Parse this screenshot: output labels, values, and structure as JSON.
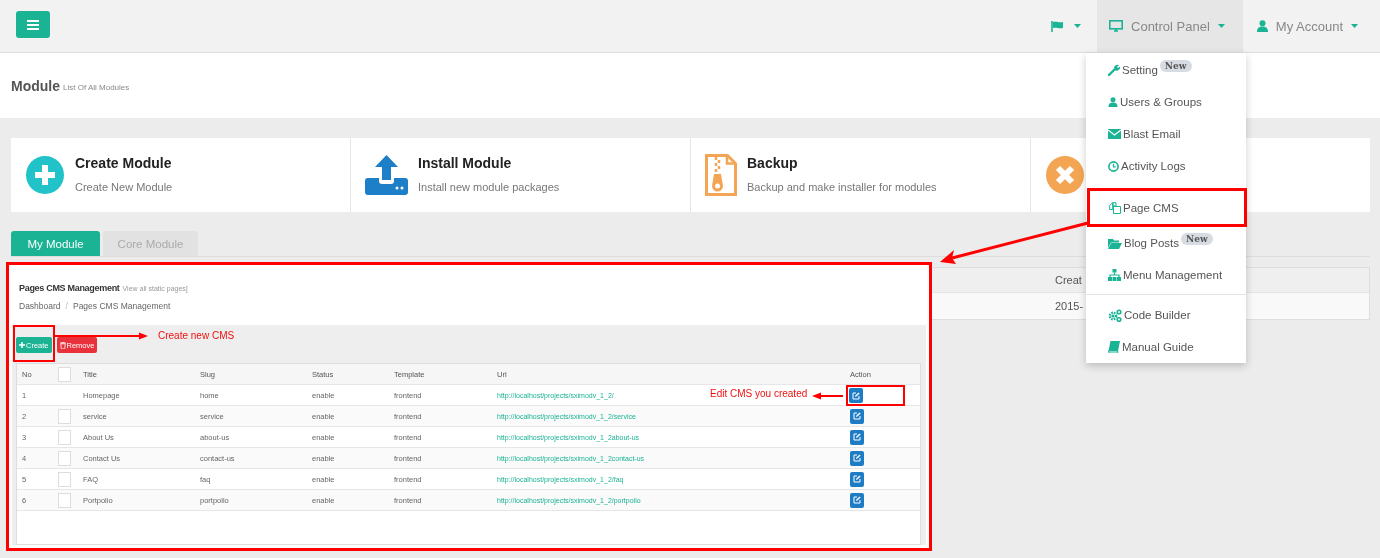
{
  "navbar": {
    "flag_menu": {
      "expanded": false
    },
    "menus": [
      {
        "label": "Control Panel",
        "expanded": true
      },
      {
        "label": "My Account",
        "expanded": false
      }
    ]
  },
  "page_header": {
    "title": "Module",
    "subtitle": "List Of All Modules"
  },
  "cards": [
    {
      "title": "Create Module",
      "description": "Create New Module"
    },
    {
      "title": "Install Module",
      "description": "Install new module packages"
    },
    {
      "title": "Backup",
      "description": "Backup and make installer for modules"
    }
  ],
  "tabs": [
    {
      "label": "My Module",
      "selected": true
    },
    {
      "label": "Core Module",
      "selected": false
    }
  ],
  "module_table": {
    "column_header": "Creat",
    "cell": "2015-"
  },
  "cms_screenshot": {
    "title": "Pages CMS Management",
    "subtitle": "View all static pages]",
    "breadcrumb": {
      "items": [
        "Dashboard",
        "Pages CMS Management"
      ],
      "separator": "/"
    },
    "buttons": [
      {
        "label": "Create",
        "kind": "primary",
        "annotated": true
      },
      {
        "label": "Remove",
        "kind": "danger",
        "annotated": false
      }
    ],
    "columns": [
      "No",
      "Title",
      "Slug",
      "Status",
      "Template",
      "Url",
      "Action"
    ],
    "select_all_checked": false,
    "rows": [
      {
        "no": "1",
        "title": "Homepage",
        "slug": "home",
        "status": "enable",
        "template": "frontend",
        "url": "http://localhost/projects/sximodv_1_2/",
        "annotated": true
      },
      {
        "no": "2",
        "checked": false,
        "title": "service",
        "slug": "service",
        "status": "enable",
        "template": "frontend",
        "url": "http://localhost/projects/sximodv_1_2/service",
        "annotated": false
      },
      {
        "no": "3",
        "checked": false,
        "title": "About Us",
        "slug": "about-us",
        "status": "enable",
        "template": "frontend",
        "url": "http://localhost/projects/sximodv_1_2about-us",
        "annotated": false
      },
      {
        "no": "4",
        "checked": false,
        "title": "Contact Us",
        "slug": "contact-us",
        "status": "enable",
        "template": "frontend",
        "url": "http://localhost/projects/sximodv_1_2contact-us",
        "annotated": false
      },
      {
        "no": "5",
        "checked": false,
        "title": "FAQ",
        "slug": "faq",
        "status": "enable",
        "template": "frontend",
        "url": "http://localhost/projects/sximodv_1_2/faq",
        "annotated": false
      },
      {
        "no": "6",
        "checked": false,
        "title": "Portpolio",
        "slug": "portpolio",
        "status": "enable",
        "template": "frontend",
        "url": "http://localhost/projects/sximodv_1_2/portpolio",
        "annotated": false
      }
    ]
  },
  "control_panel_menu": {
    "groups": [
      {
        "items": [
          {
            "label": "Setting",
            "badge": "New",
            "annotated": false
          },
          {
            "label": "Users & Groups",
            "annotated": false
          },
          {
            "label": "Blast Email",
            "annotated": false
          },
          {
            "label": "Activity Logs",
            "annotated": false
          },
          {
            "label": "Page CMS",
            "annotated": true
          },
          {
            "label": "Blog Posts",
            "badge": "New",
            "annotated": false
          },
          {
            "label": "Menu Management",
            "annotated": false
          }
        ]
      },
      {
        "items": [
          {
            "label": "Code Builder",
            "annotated": false
          },
          {
            "label": "Manual Guide",
            "annotated": false
          }
        ]
      }
    ]
  },
  "annotations": [
    {
      "text": "Create new CMS"
    },
    {
      "text": "Edit CMS you created"
    }
  ]
}
